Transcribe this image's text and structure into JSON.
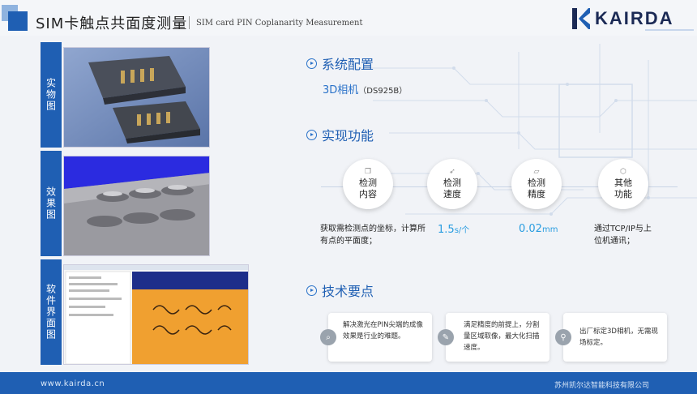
{
  "header": {
    "title_cn": "SIM卡触点共面度测量",
    "title_en": "SIM card PIN Coplanarity Measurement",
    "logo_text": "KAIRDA"
  },
  "left_panels": [
    {
      "label": "实物图"
    },
    {
      "label": "效果图"
    },
    {
      "label": "软件界面图"
    }
  ],
  "config": {
    "title": "系统配置",
    "camera": "3D相机",
    "camera_model": "（DS925B）"
  },
  "functions": {
    "title": "实现功能",
    "items": [
      {
        "label": "检测内容",
        "desc": "获取需检测点的坐标，计算所有点的平面度；"
      },
      {
        "label": "检测速度",
        "value": "1.5",
        "unit": "s/个"
      },
      {
        "label": "检测精度",
        "value": "0.02",
        "unit": "mm"
      },
      {
        "label": "其他功能",
        "desc": "通过TCP/IP与上位机通讯；"
      }
    ]
  },
  "tech": {
    "title": "技术要点",
    "items": [
      {
        "text": "解决激光在PIN尖端的成像效果是行业的难题。",
        "icon": "search-icon"
      },
      {
        "text": "满足精度的前提上，分割量区域取像，最大化扫描速度。",
        "icon": "edit-icon"
      },
      {
        "text": "出厂标定3D相机，无需现场标定。",
        "icon": "pin-icon"
      }
    ]
  },
  "footer": {
    "url": "www.kairda.cn",
    "company": "苏州凯尔达智能科技有限公司"
  },
  "colors": {
    "brand": "#1f5fb3",
    "accent": "#2a9de0"
  }
}
